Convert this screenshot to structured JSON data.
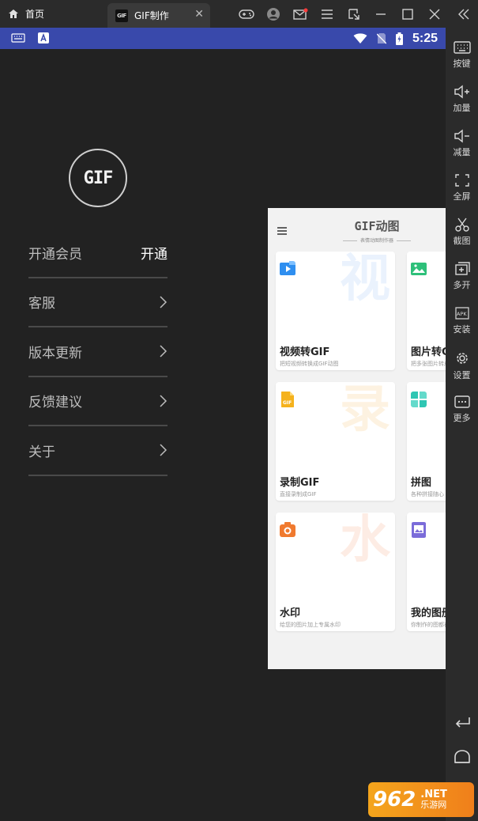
{
  "emulator": {
    "home_tab_label": "首页",
    "app_tab_label": "GIF制作",
    "app_tab_chip": "GIF"
  },
  "status_bar": {
    "time": "5:25",
    "colors": {
      "bar": "#3949ab"
    }
  },
  "app": {
    "logo_text": "GIF",
    "menu": [
      {
        "label": "开通会员",
        "value": "开通"
      },
      {
        "label": "客服"
      },
      {
        "label": "版本更新"
      },
      {
        "label": "反馈建议"
      },
      {
        "label": "关于"
      }
    ],
    "preview": {
      "title": "GIF动图",
      "subtitle": "表情动图制作器",
      "cards": [
        {
          "title": "视频转GIF",
          "desc": "把短视频转换成GIF动图",
          "big_char": "视",
          "icon": "video-icon",
          "color": "#2f8ff0"
        },
        {
          "title": "图片转GIF",
          "desc": "把多张图片转成动图",
          "big_char": "",
          "icon": "image-icon",
          "color": "#2ec07a"
        },
        {
          "title": "录制GIF",
          "desc": "直接录制成GIF",
          "big_char": "录",
          "icon": "gif-file-icon",
          "color": "#f5b21d"
        },
        {
          "title": "拼图",
          "desc": "各种拼接随心",
          "big_char": "",
          "icon": "puzzle-icon",
          "color": "#2fc6b3"
        },
        {
          "title": "水印",
          "desc": "给您的图片加上专属水印",
          "big_char": "水",
          "icon": "camera-icon",
          "color": "#f07a2f"
        },
        {
          "title": "我的图册",
          "desc": "你制作的图都在这里",
          "big_char": "",
          "icon": "album-icon",
          "color": "#7b6cd9"
        }
      ]
    }
  },
  "sidebar": {
    "items": [
      {
        "label": "按键",
        "icon": "keyboard-icon"
      },
      {
        "label": "加量",
        "icon": "volume-up-icon"
      },
      {
        "label": "减量",
        "icon": "volume-down-icon"
      },
      {
        "label": "全屏",
        "icon": "fullscreen-icon"
      },
      {
        "label": "截图",
        "icon": "scissors-icon"
      },
      {
        "label": "多开",
        "icon": "multi-window-icon"
      },
      {
        "label": "安装",
        "icon": "apk-install-icon"
      },
      {
        "label": "设置",
        "icon": "gear-icon"
      },
      {
        "label": "更多",
        "icon": "more-icon"
      }
    ]
  },
  "watermark": {
    "number": "962",
    "net": ".NET",
    "cn": "乐游网"
  }
}
